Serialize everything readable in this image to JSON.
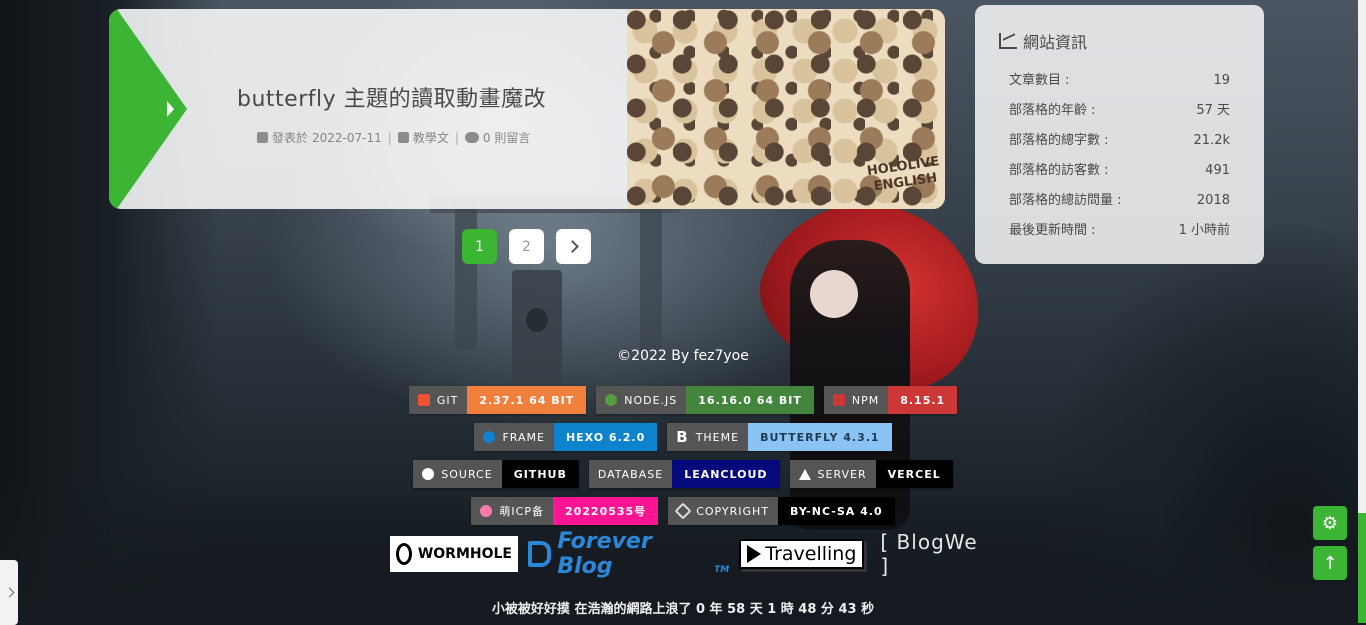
{
  "article": {
    "title": "butterfly 主題的讀取動畫魔改",
    "meta": {
      "date_prefix": "發表於",
      "date": "2022-07-11",
      "category": "教學文",
      "comments": "0 則留言"
    },
    "cover_text_line1": "HOLOLIVE",
    "cover_text_line2": "ENGLISH"
  },
  "pagination": {
    "pages": [
      "1",
      "2"
    ],
    "current": "1"
  },
  "widget": {
    "title": "網站資訊",
    "rows": [
      {
        "label": "文章數目 :",
        "value": "19"
      },
      {
        "label": "部落格的年齡 :",
        "value": "57 天"
      },
      {
        "label": "部落格的總字數 :",
        "value": "21.2k"
      },
      {
        "label": "部落格的訪客數 :",
        "value": "491"
      },
      {
        "label": "部落格的總訪問量 :",
        "value": "2018"
      },
      {
        "label": "最後更新時間 :",
        "value": "1 小時前"
      }
    ]
  },
  "footer": {
    "copyright": "©2022 By fez7yoe",
    "badges": [
      [
        {
          "label": "GIT",
          "value": "2.37.1 64 BIT",
          "color": "#f0803c",
          "icon_color": "#f05033",
          "icon": "git-icon"
        },
        {
          "label": "NODE.JS",
          "value": "16.16.0 64 BIT",
          "color": "#43853d",
          "icon_color": "#539e43",
          "icon": "nodejs-icon"
        },
        {
          "label": "NPM",
          "value": "8.15.1",
          "color": "#cb3837",
          "icon_color": "#cb3837",
          "icon": "npm-icon"
        }
      ],
      [
        {
          "label": "FRAME",
          "value": "HEXO 6.2.0",
          "color": "#0e83cd",
          "icon_color": "#0e83cd",
          "icon": "hexo-icon"
        },
        {
          "label": "THEME",
          "value": "BUTTERFLY 4.3.1",
          "color": "#8ac4f5",
          "icon_color": "#ffffff",
          "icon": "butterfly-b-icon"
        }
      ],
      [
        {
          "label": "SOURCE",
          "value": "GITHUB",
          "color": "#000000",
          "icon_color": "#ffffff",
          "icon": "github-icon"
        },
        {
          "label": "DATABASE",
          "value": "LEANCLOUD",
          "color": "#06097c",
          "icon_color": "#555555",
          "icon": "database-icon"
        },
        {
          "label": "SERVER",
          "value": "VERCEL",
          "color": "#000000",
          "icon_color": "#ffffff",
          "icon": "vercel-triangle-icon"
        }
      ],
      [
        {
          "label": "萌ICP备",
          "value": "20220535号",
          "color": "#ff1493",
          "icon_color": "#ff7aa8",
          "icon": "moe-icp-icon"
        },
        {
          "label": "COPYRIGHT",
          "value": "BY-NC-SA 4.0",
          "color": "#000000",
          "icon_color": "#dddddd",
          "icon": "creative-commons-icon"
        }
      ]
    ],
    "banners": {
      "wormhole": "WORMHOLE",
      "forever": "Forever Blog",
      "forever_tm": "TM",
      "travelling": "Travelling",
      "blogwe": "[ BlogWe ]"
    },
    "runtime": "小被被好好摸 在浩瀚的網路上浪了 0 年 58 天 1 時 48 分 43 秒"
  },
  "controls": {
    "settings_icon": "gear-icon",
    "top_icon": "arrow-up-icon"
  }
}
